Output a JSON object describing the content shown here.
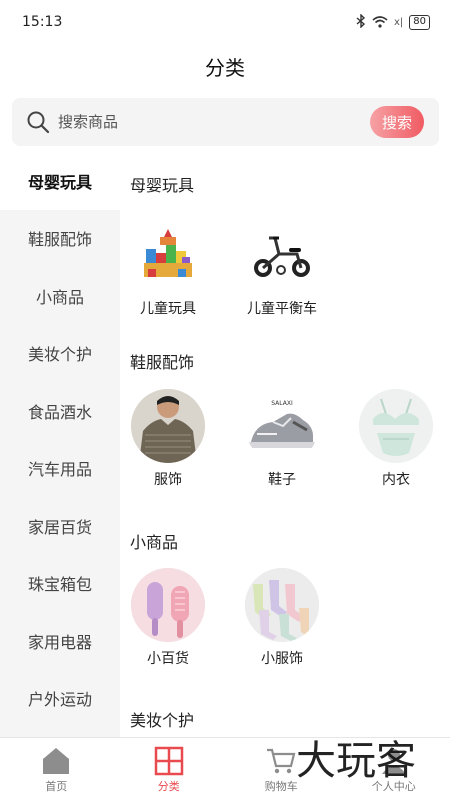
{
  "status_bar": {
    "time": "15:13",
    "battery": "80",
    "signal": "x|"
  },
  "header": {
    "title": "分类"
  },
  "search": {
    "placeholder": "搜索商品",
    "button": "搜索"
  },
  "sidebar": {
    "items": [
      {
        "label": "母婴玩具",
        "active": true
      },
      {
        "label": "鞋服配饰"
      },
      {
        "label": "小商品"
      },
      {
        "label": "美妆个护"
      },
      {
        "label": "食品酒水"
      },
      {
        "label": "汽车用品"
      },
      {
        "label": "家居百货"
      },
      {
        "label": "珠宝箱包"
      },
      {
        "label": "家用电器"
      },
      {
        "label": "户外运动"
      }
    ]
  },
  "sections": [
    {
      "title": "母婴玩具",
      "products": [
        {
          "name": "儿童玩具",
          "image": "toy-blocks"
        },
        {
          "name": "儿童平衡车",
          "image": "balance-bike"
        }
      ]
    },
    {
      "title": "鞋服配饰",
      "products": [
        {
          "name": "服饰",
          "image": "man-tshirt"
        },
        {
          "name": "鞋子",
          "image": "sneaker",
          "brand_text": "SALAXI"
        },
        {
          "name": "内衣",
          "image": "lingerie"
        }
      ]
    },
    {
      "title": "小商品",
      "products": [
        {
          "name": "小百货",
          "image": "hair-comb"
        },
        {
          "name": "小服饰",
          "image": "socks"
        }
      ]
    },
    {
      "title": "美妆个护",
      "products": []
    }
  ],
  "tabbar": {
    "items": [
      {
        "label": "首页",
        "icon": "home-icon"
      },
      {
        "label": "分类",
        "icon": "category-icon",
        "active": true
      },
      {
        "label": "购物车",
        "icon": "cart-icon"
      },
      {
        "label": "个人中心",
        "icon": "user-icon"
      }
    ]
  },
  "watermark": {
    "text": "大玩客"
  },
  "colors": {
    "accent": "#e84a4f",
    "search_button_start": "#f6a2a5",
    "search_button_end": "#f05b63",
    "sidebar_bg": "#f5f5f5",
    "tab_inactive": "#777777"
  }
}
